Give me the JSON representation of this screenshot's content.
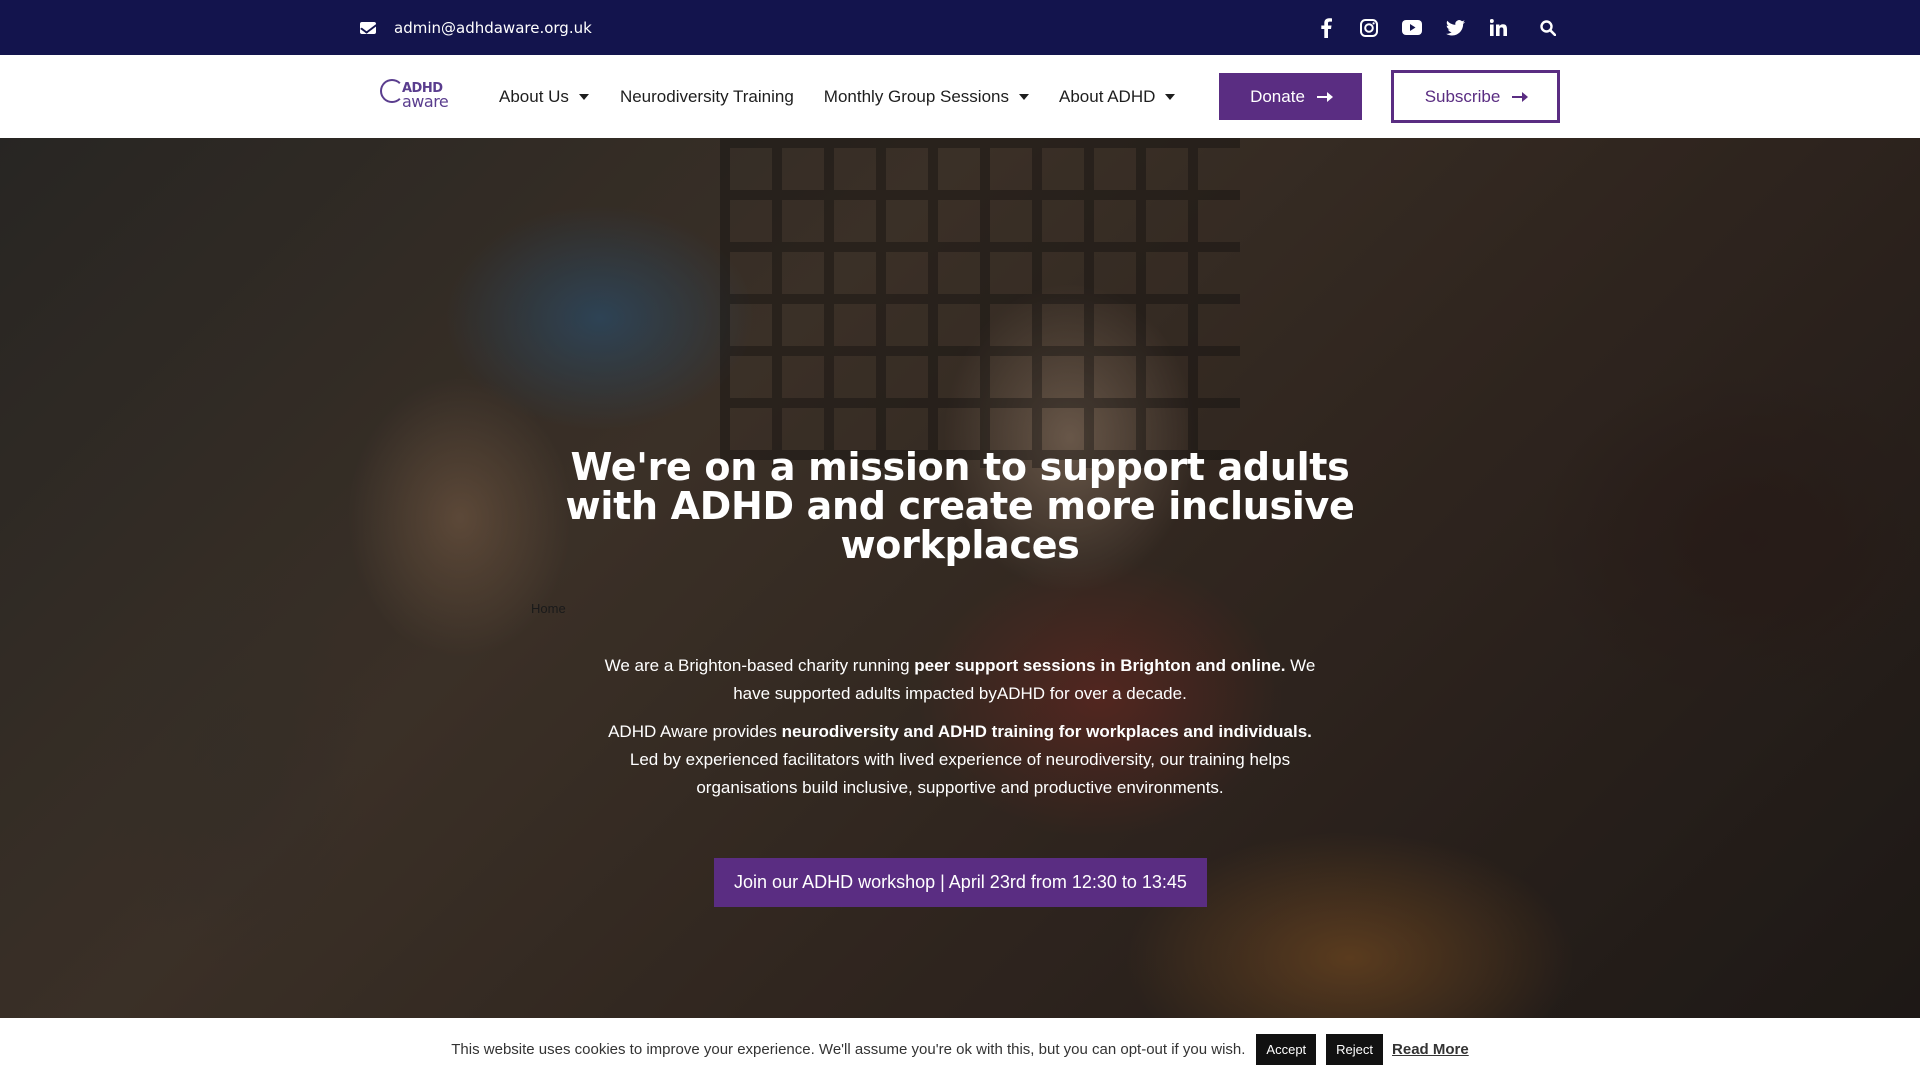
{
  "topbar": {
    "email": "admin@adhdaware.org.uk",
    "socials": [
      "facebook-icon",
      "instagram-icon",
      "youtube-icon",
      "twitter-icon",
      "linkedin-icon",
      "search-icon"
    ]
  },
  "nav": {
    "logo_top": "ADHD",
    "logo_bottom": "aware",
    "items": [
      {
        "label": "About Us",
        "dropdown": true
      },
      {
        "label": "Neurodiversity Training",
        "dropdown": false
      },
      {
        "label": "Monthly Group Sessions",
        "dropdown": true
      },
      {
        "label": "About ADHD",
        "dropdown": true
      }
    ],
    "donate": "Donate",
    "subscribe": "Subscribe"
  },
  "hero": {
    "title": "We're on a mission to support adults with ADHD and create more inclusive workplaces",
    "breadcrumb": "Home",
    "p1_a": "We are a Brighton-based charity running ",
    "p1_b": "peer support sessions in Brighton and online.",
    "p1_c": " We have supported adults impacted byADHD for over a decade.",
    "p2_a": "ADHD Aware provides ",
    "p2_b": "neurodiversity and ADHD training for workplaces and individuals.",
    "p2_c": " Led by experienced facilitators with lived experience of neurodiversity, our training helps organisations build inclusive, supportive and productive environments.",
    "cta": "Join our ADHD workshop | April 23rd from 12:30 to 13:45"
  },
  "cookie": {
    "text": "This website uses cookies to improve your experience. We'll assume you're ok with this, but you can opt-out if you wish.",
    "accept": "Accept",
    "reject": "Reject",
    "read_more": "Read More"
  },
  "colors": {
    "topbar": "#13144d",
    "brand_purple": "#5a2d82"
  }
}
